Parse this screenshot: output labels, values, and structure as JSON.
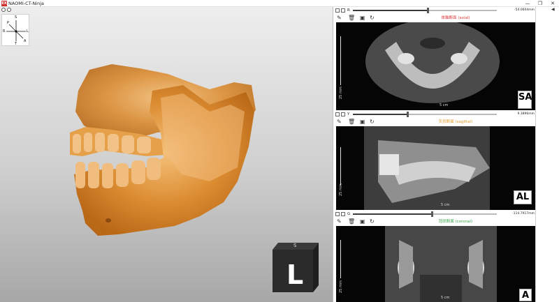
{
  "window": {
    "icon_label": "EX",
    "title": "NAOMI-CT-Ninja",
    "minimize_label": "—",
    "maximize_label": "❐",
    "close_label": "✕"
  },
  "viewer3d": {
    "compass": {
      "p": "P",
      "s": "S",
      "r": "R",
      "l": "L",
      "t": "T",
      "a": "A"
    },
    "cube_face": "L",
    "cube_top": "S",
    "bone_color": "#d9892d"
  },
  "panels": [
    {
      "axis": "R",
      "readout": "-54.0604mm",
      "slider_position": 0.52,
      "caption": "体軸断面 (axial)",
      "caption_color": "#e03a3a",
      "scale_label": "25 mm",
      "cm_label": "5 cm",
      "orientation": "SA"
    },
    {
      "axis": "Y",
      "readout": "9.3896mm",
      "slider_position": 0.38,
      "caption": "矢状断面 (sagittal)",
      "caption_color": "#e39b2a",
      "scale_label": "25 mm",
      "cm_label": "5 cm",
      "orientation": "AL"
    },
    {
      "axis": "G",
      "readout": "-114.7917mm",
      "slider_position": 0.55,
      "caption": "冠状断面 (coronal)",
      "caption_color": "#3aa64a",
      "scale_label": "25 mm",
      "cm_label": "5 cm",
      "orientation": "A"
    }
  ],
  "right_panel": {
    "collapse_label": "◀"
  }
}
